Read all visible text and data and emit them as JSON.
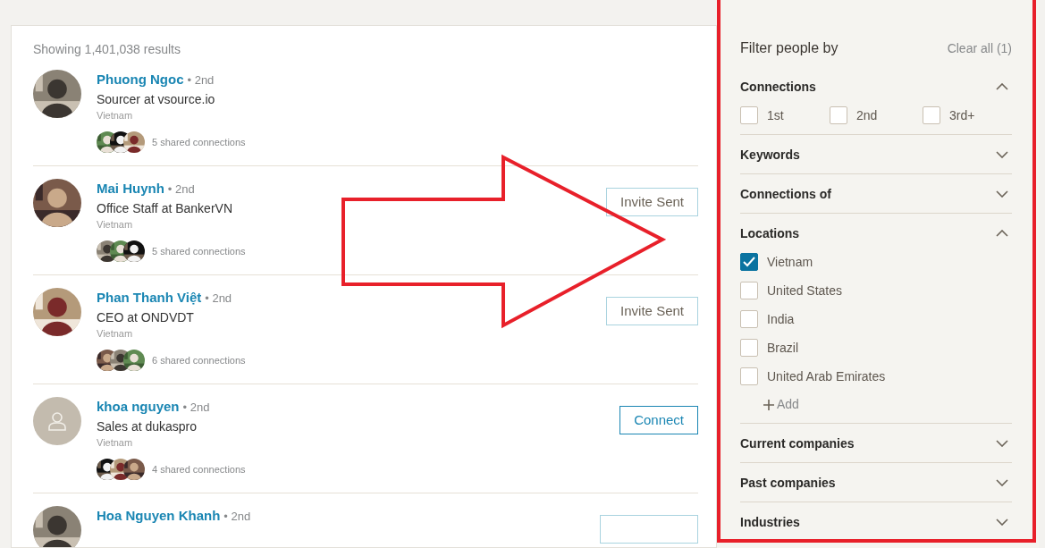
{
  "results_count": "Showing 1,401,038 results",
  "people": [
    {
      "name": "Phuong Ngoc",
      "degree": "• 2nd",
      "headline": "Sourcer at vsource.io",
      "location": "Vietnam",
      "shared": "5 shared connections",
      "action": {
        "kind": "none"
      }
    },
    {
      "name": "Mai Huynh",
      "degree": "• 2nd",
      "headline": "Office Staff at BankerVN",
      "location": "Vietnam",
      "shared": "5 shared connections",
      "action": {
        "kind": "sent",
        "label": "Invite Sent"
      }
    },
    {
      "name": "Phan Thanh Việt",
      "degree": "• 2nd",
      "headline": "CEO at ONDVDT",
      "location": "Vietnam",
      "shared": "6 shared connections",
      "action": {
        "kind": "sent",
        "label": "Invite Sent"
      }
    },
    {
      "name": "khoa nguyen",
      "degree": "• 2nd",
      "headline": "Sales at dukaspro",
      "location": "Vietnam",
      "avatar": {
        "kind": "placeholder"
      },
      "shared": "4 shared connections",
      "action": {
        "kind": "connect",
        "label": "Connect"
      }
    },
    {
      "name": "Hoa Nguyen Khanh",
      "degree": "• 2nd",
      "action": {
        "kind": "sent"
      }
    }
  ],
  "filter": {
    "title": "Filter people by",
    "clear": "Clear all (1)",
    "sections": [
      {
        "title": "Connections",
        "expanded": true,
        "kind": "inline",
        "options": [
          {
            "label": "1st",
            "checked": false
          },
          {
            "label": "2nd",
            "checked": false
          },
          {
            "label": "3rd+",
            "checked": false
          }
        ]
      },
      {
        "title": "Keywords",
        "expanded": false
      },
      {
        "title": "Connections of",
        "expanded": false
      },
      {
        "title": "Locations",
        "expanded": true,
        "kind": "stacked",
        "options": [
          {
            "label": "Vietnam",
            "checked": true
          },
          {
            "label": "United States",
            "checked": false
          },
          {
            "label": "India",
            "checked": false
          },
          {
            "label": "Brazil",
            "checked": false
          },
          {
            "label": "United Arab Emirates",
            "checked": false
          }
        ],
        "add": "Add"
      },
      {
        "title": "Current companies",
        "expanded": false
      },
      {
        "title": "Past companies",
        "expanded": false
      },
      {
        "title": "Industries",
        "expanded": false
      }
    ]
  },
  "annotations": {
    "arrow": true,
    "frame": true
  }
}
